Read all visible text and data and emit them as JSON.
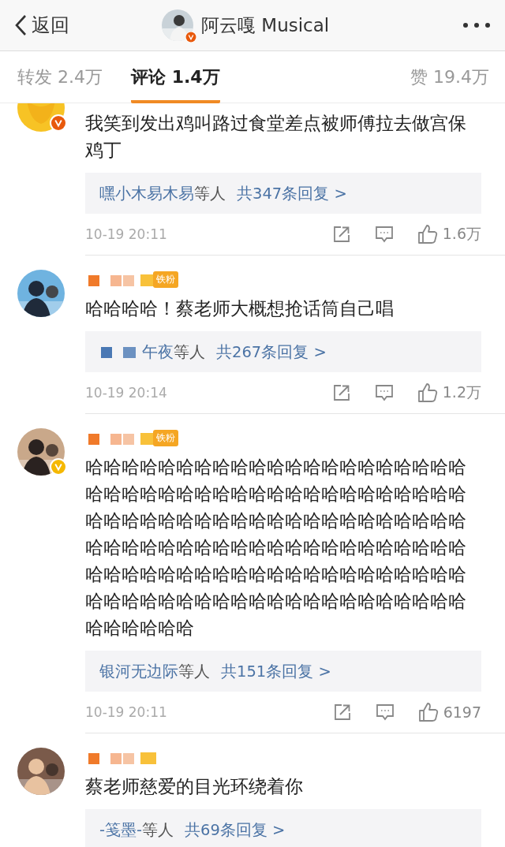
{
  "header": {
    "back": "返回",
    "account": {
      "name": "阿云嘎 Musical",
      "badge": {
        "color": "#e8590c"
      }
    }
  },
  "tabs": [
    {
      "label": "转发 2.4万",
      "selected": false
    },
    {
      "label": "评论 1.4万",
      "selected": true
    },
    {
      "label": "赞 19.4万",
      "selected": false
    }
  ],
  "comments": [
    {
      "avatar": {
        "kind": "emoji"
      },
      "badge": {
        "color": "#e8590c"
      },
      "text": "我笑到发出鸡叫路过食堂差点被师傅拉去做宫保鸡丁",
      "reply": {
        "names": "嘿小木易木易",
        "others": "等人",
        "total": "共347条回复 >"
      },
      "footer": {
        "time": "10-19 20:11",
        "likes": "1.6万"
      }
    },
    {
      "fan_badge": "铁粉",
      "text": "哈哈哈哈！蔡老师大概想抢话筒自己唱",
      "reply": {
        "names_redacted": true,
        "names": "午夜",
        "others": "等人",
        "total": "共267条回复 >"
      },
      "footer": {
        "time": "10-19 20:14",
        "likes": "1.2万"
      }
    },
    {
      "badge": {
        "color": "#f5b800"
      },
      "fan_badge": "铁粉",
      "text": "哈哈哈哈哈哈哈哈哈哈哈哈哈哈哈哈哈哈哈哈哈哈哈哈哈哈哈哈哈哈哈哈哈哈哈哈哈哈哈哈哈哈哈哈哈哈哈哈哈哈哈哈哈哈哈哈哈哈哈哈哈哈哈哈哈哈哈哈哈哈哈哈哈哈哈哈哈哈哈哈哈哈哈哈哈哈哈哈哈哈哈哈哈哈哈哈哈哈哈哈哈哈哈哈哈哈哈哈哈哈哈哈哈哈哈哈哈哈哈哈哈哈哈哈哈哈哈哈哈哈哈哈",
      "reply": {
        "names": "银河无边际",
        "others": "等人",
        "total": "共151条回复 >"
      },
      "footer": {
        "time": "10-19 20:11",
        "likes": "6197"
      }
    },
    {
      "text": "蔡老师慈爱的目光环绕着你",
      "reply": {
        "names": "-笺墨-",
        "others": "等人",
        "total": "共69条回复 >"
      }
    }
  ]
}
